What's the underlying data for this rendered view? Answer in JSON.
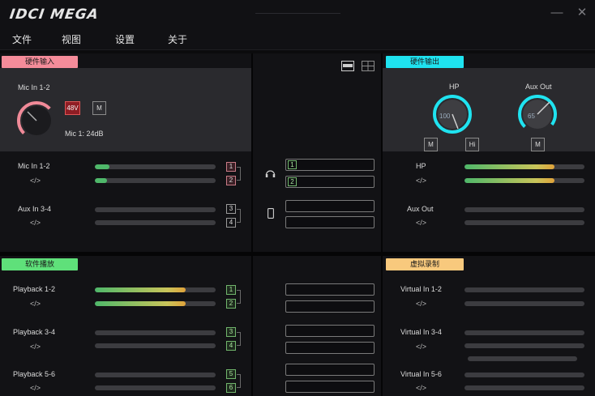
{
  "app": {
    "logo": "IDCI MEGA"
  },
  "window": {
    "minimize": "—",
    "close": "✕"
  },
  "menu": {
    "items": [
      "文件",
      "视图",
      "设置",
      "关于"
    ]
  },
  "hw_input": {
    "tag": "硬件输入",
    "header_label": "Mic In 1-2",
    "btn_48v": "48V",
    "btn_mute": "M",
    "gain_text": "Mic 1: 24dB",
    "channels": [
      {
        "name": "Mic In 1-2",
        "code": "</>",
        "levels": [
          0.12,
          0.1
        ],
        "boxes": [
          "1",
          "2"
        ],
        "highlight": true
      },
      {
        "name": "Aux In 3-4",
        "code": "</>",
        "levels": [
          0.0,
          0.0
        ],
        "boxes": [
          "3",
          "4"
        ],
        "highlight": false
      }
    ]
  },
  "hw_output": {
    "tag": "硬件输出",
    "knobs": [
      {
        "label": "HP",
        "value": "100",
        "level": 1.0
      },
      {
        "label": "Aux Out",
        "value": "65",
        "level": 0.65
      }
    ],
    "btn_hp_m": "M",
    "btn_hp_hi": "Hi",
    "btn_aux_m": "M",
    "channels": [
      {
        "name": "HP",
        "code": "</>",
        "levels": [
          0.75,
          0.75
        ]
      },
      {
        "name": "Aux Out",
        "code": "</>",
        "levels": [
          0.0,
          0.0
        ]
      }
    ]
  },
  "routing": {
    "hp_boxes": [
      "1",
      "2"
    ]
  },
  "sw_playback": {
    "tag": "软件播放",
    "channels": [
      {
        "name": "Playback 1-2",
        "code": "</>",
        "levels": [
          0.75,
          0.75
        ],
        "boxes": [
          "1",
          "2"
        ]
      },
      {
        "name": "Playback 3-4",
        "code": "</>",
        "levels": [
          0.0,
          0.0
        ],
        "boxes": [
          "3",
          "4"
        ]
      },
      {
        "name": "Playback 5-6",
        "code": "</>",
        "levels": [
          0.0,
          0.0
        ],
        "boxes": [
          "5",
          "6"
        ]
      }
    ]
  },
  "virtual_rec": {
    "tag": "虚拟录制",
    "channels": [
      {
        "name": "Virtual In 1-2",
        "code": "</>"
      },
      {
        "name": "Virtual In 3-4",
        "code": "</>"
      },
      {
        "name": "Virtual In 5-6",
        "code": "</>"
      }
    ]
  },
  "colors": {
    "accent_cyan": "#1fe3f0",
    "meter_green": "#4fb86a",
    "meter_yellow": "#e0a23a",
    "mute_red": "#8f1d24"
  }
}
